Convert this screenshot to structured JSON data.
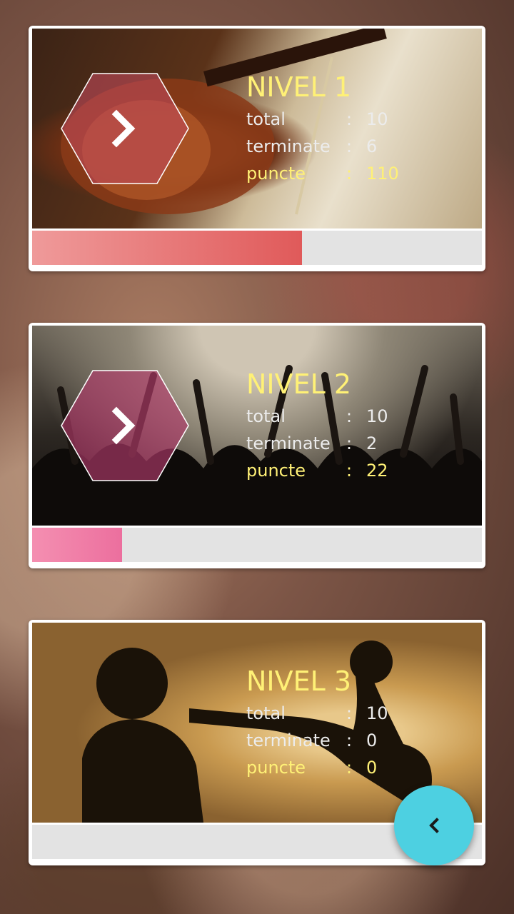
{
  "levels": [
    {
      "title": "NIVEL 1",
      "total_label": "total",
      "total_value": "10",
      "done_label": "terminate",
      "done_value": "6",
      "points_label": "puncte",
      "points_value": "110",
      "separator": ":",
      "progress": 0.6,
      "progress_colors": [
        "#ef9a9a",
        "#e05a5a"
      ],
      "hex_color": "#c04a5a",
      "has_arrow": true
    },
    {
      "title": "NIVEL 2",
      "total_label": "total",
      "total_value": "10",
      "done_label": "terminate",
      "done_value": "2",
      "points_label": "puncte",
      "points_value": "22",
      "separator": ":",
      "progress": 0.2,
      "progress_colors": [
        "#f48fb1",
        "#ec6f9e"
      ],
      "hex_color": "#b03a6a",
      "has_arrow": true
    },
    {
      "title": "NIVEL 3",
      "total_label": "total",
      "total_value": "10",
      "done_label": "terminate",
      "done_value": "0",
      "points_label": "puncte",
      "points_value": "0",
      "separator": ":",
      "progress": 0,
      "progress_colors": [
        "#e3e3e3",
        "#e3e3e3"
      ],
      "hex_color": "",
      "has_arrow": false
    }
  ],
  "fab": {
    "icon": "chevron-left-icon",
    "color": "#4dd0e1"
  }
}
